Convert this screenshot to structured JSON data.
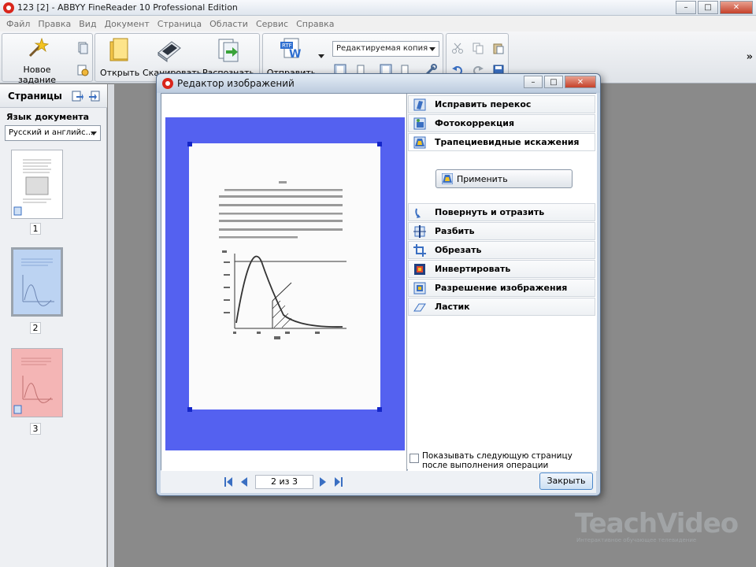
{
  "window": {
    "title": "123 [2] - ABBYY FineReader 10 Professional Edition"
  },
  "menu": [
    "Файл",
    "Правка",
    "Вид",
    "Документ",
    "Страница",
    "Области",
    "Сервис",
    "Справка"
  ],
  "toolbar": {
    "new_task": "Новое задание",
    "open": "Открыть",
    "scan": "Сканировать",
    "recognize": "Распознать",
    "send": "Отправить",
    "output_format": "Редактируемая копия"
  },
  "pages_panel": {
    "title": "Страницы",
    "language_label": "Язык документа",
    "language_value": "Русский и английс...",
    "pages": [
      {
        "number": "1",
        "color": "#ffffff"
      },
      {
        "number": "2",
        "color": "#bcd3f2"
      },
      {
        "number": "3",
        "color": "#f4b5b5"
      }
    ]
  },
  "dialog": {
    "title": "Редактор изображений",
    "operations": [
      {
        "label": "Исправить перекос",
        "icon": "deskew-icon"
      },
      {
        "label": "Фотокоррекция",
        "icon": "photo-correction-icon"
      },
      {
        "label": "Трапециевидные искажения",
        "icon": "trapezoid-icon"
      },
      {
        "label": "Повернуть и отразить",
        "icon": "rotate-icon"
      },
      {
        "label": "Разбить",
        "icon": "split-icon"
      },
      {
        "label": "Обрезать",
        "icon": "crop-icon"
      },
      {
        "label": "Инвертировать",
        "icon": "invert-icon"
      },
      {
        "label": "Разрешение изображения",
        "icon": "resolution-icon"
      },
      {
        "label": "Ластик",
        "icon": "eraser-icon"
      }
    ],
    "apply_label": "Применить",
    "checkbox_label": "Показывать следующую страницу после выполнения операции",
    "page_counter": "2 из 3",
    "close_label": "Закрыть"
  },
  "watermark": {
    "brand": "TeachVideo",
    "tagline": "Интерактивное обучающее телевидение"
  }
}
